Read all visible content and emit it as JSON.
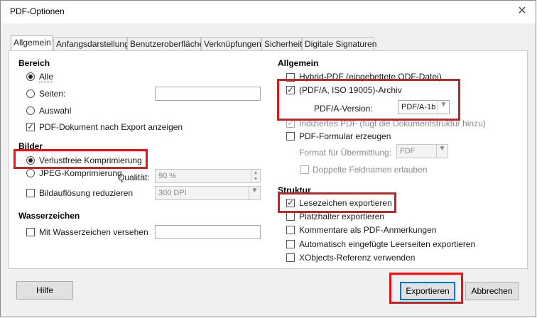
{
  "window": {
    "title": "PDF-Optionen",
    "close_glyph": "✕"
  },
  "tabs": [
    {
      "label": "Allgemein",
      "active": true
    },
    {
      "label": "Anfangsdarstellung"
    },
    {
      "label": "Benutzeroberfläche"
    },
    {
      "label": "Verknüpfungen"
    },
    {
      "label": "Sicherheit"
    },
    {
      "label": "Digitale Signaturen"
    }
  ],
  "left": {
    "bereich": {
      "heading": "Bereich",
      "alle": "Alle",
      "seiten": "Seiten:",
      "auswahl": "Auswahl",
      "show_after_export": "PDF-Dokument nach Export anzeigen",
      "selected": "Alle"
    },
    "bilder": {
      "heading": "Bilder",
      "lossless": "Verlustfreie Komprimierung",
      "jpeg": "JPEG-Komprimierung",
      "quality_label": "Qualität:",
      "quality_value": "90 %",
      "reduce_res": "Bildauflösung reduzieren",
      "dpi_value": "300 DPI",
      "selected": "Verlustfreie Komprimierung"
    },
    "wasserzeichen": {
      "heading": "Wasserzeichen",
      "sign": "Mit Wasserzeichen versehen"
    }
  },
  "right": {
    "allgemein": {
      "heading": "Allgemein",
      "hybrid": "Hybrid-PDF (eingebettete ODF-Datei)",
      "pdfa": "(PDF/A, ISO 19005)-Archiv",
      "pdfa_version_label": "PDF/A-Version:",
      "pdfa_version_value": "PDF/A-1b",
      "tagged": "Indiziertes PDF (fügt die Dokumentstruktur hinzu)",
      "form": "PDF-Formular erzeugen",
      "format_label": "Format für Übermittlung:",
      "format_value": "FDF",
      "dup_fields": "Doppelte Feldnamen erlauben"
    },
    "struktur": {
      "heading": "Struktur",
      "bookmarks": "Lesezeichen exportieren",
      "placeholders": "Platzhalter exportieren",
      "comments": "Kommentare als PDF-Anmerkungen",
      "empty_pages": "Automatisch eingefügte Leerseiten exportieren",
      "xobjects": "XObjects-Referenz verwenden"
    }
  },
  "buttons": {
    "help": "Hilfe",
    "export": "Exportieren",
    "cancel": "Abbrechen"
  },
  "colors": {
    "highlight": "#e4141b",
    "accent": "#0078d7"
  }
}
